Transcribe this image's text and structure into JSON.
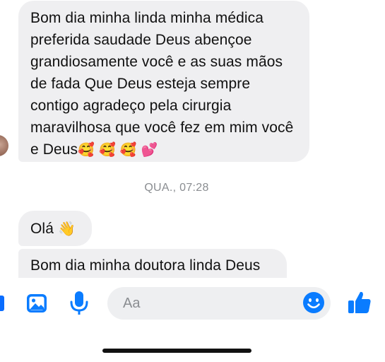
{
  "conversation": {
    "message_1": "Bom dia minha linda minha médica preferida saudade Deus abençoe grandiosamente você e as suas mãos de fada Que Deus esteja sempre contigo agradeço pela cirurgia maravilhosa que você fez em mim você e Deus",
    "message_1_emojis": "🥰 🥰 🥰 💕",
    "timestamp": "QUA., 07:28",
    "message_2": "Olá",
    "message_2_emoji": "👋",
    "message_3": "Bom dia minha doutora linda Deus"
  },
  "composer": {
    "placeholder": "Aa"
  },
  "colors": {
    "accent": "#0a7cff",
    "bubble_bg": "#efeff1",
    "timestamp": "#8a8d91"
  },
  "icons": {
    "left": "menu-icon",
    "photo": "photo-icon",
    "mic": "microphone-icon",
    "emoji": "emoji-icon",
    "like": "thumbs-up-icon"
  }
}
